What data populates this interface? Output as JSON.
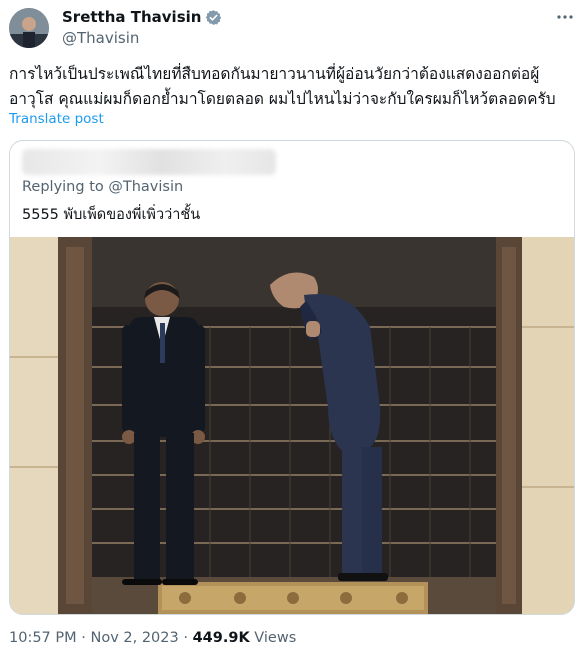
{
  "author": {
    "name": "Srettha Thavisin",
    "handle": "@Thavisin"
  },
  "menu_icon": "more-dots-icon",
  "tweet_text": "การไหว้เป็นประเพณีไทยที่สืบทอดกันมายาวนานที่ผู้อ่อนวัยกว่าต้องแสดงออกต่อผู้อาวุโส คุณแม่ผมก็ดอกย้ำมาโดยตลอด ผมไปไหนไม่ว่าจะกับใครผมก็ไหว้ตลอดครับ",
  "translate_label": "Translate post",
  "quote": {
    "replying_to": "Replying to @Thavisin",
    "text": "5555 พับเพ็ดของพี่เพิ่วว่าชั้น"
  },
  "footer": {
    "time": "10:57 PM",
    "date": "Nov 2, 2023",
    "views_count": "449.9K",
    "views_label": "Views"
  },
  "colors": {
    "link": "#1d9bf0",
    "secondary_text": "#536471",
    "verified_badge": "#829aab"
  }
}
